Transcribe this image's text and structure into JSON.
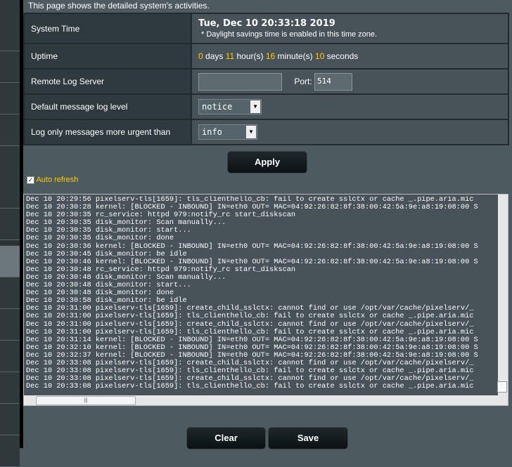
{
  "intro": "This page shows the detailed system's activities.",
  "rows": {
    "system_time": {
      "label": "System Time",
      "value": "Tue, Dec 10 20:33:18 2019",
      "note": "* Daylight savings time is enabled in this time zone."
    },
    "uptime": {
      "label": "Uptime",
      "days": "0",
      "days_label": " days ",
      "hours": "11",
      "hours_label": " hour(s) ",
      "minutes": "16",
      "minutes_label": " minute(s) ",
      "seconds": "10",
      "seconds_label": " seconds"
    },
    "remote_log": {
      "label": "Remote Log Server",
      "value": "",
      "port_label": "Port:",
      "port": "514"
    },
    "default_level": {
      "label": "Default message log level",
      "value": "notice"
    },
    "urgent": {
      "label": "Log only messages more urgent than",
      "value": "info"
    }
  },
  "apply_label": "Apply",
  "auto_refresh": {
    "label": "Auto refresh",
    "checked": true
  },
  "log_lines": [
    "Dec 10 20:29:56 pixelserv-tls[1659]: tls_clienthello_cb: fail to create sslctx or cache _.pipe.aria.mic",
    "Dec 10 20:30:28 kernel: [BLOCKED - INBOUND] IN=eth0 OUT= MAC=04:92:26:82:8f:38:00:42:5a:9e:a8:19:08:00 S",
    "Dec 10 20:30:35 rc_service: httpd 979:notify_rc start_diskscan",
    "Dec 10 20:30:35 disk_monitor: Scan manually...",
    "Dec 10 20:30:35 disk_monitor: start...",
    "Dec 10 20:30:35 disk_monitor: done",
    "Dec 10 20:30:36 kernel: [BLOCKED - INBOUND] IN=eth0 OUT= MAC=04:92:26:82:8f:38:00:42:5a:9e:a8:19:08:00 S",
    "Dec 10 20:30:45 disk_monitor: be idle",
    "Dec 10 20:30:46 kernel: [BLOCKED - INBOUND] IN=eth0 OUT= MAC=04:92:26:82:8f:38:00:42:5a:9e:a8:19:08:00 S",
    "Dec 10 20:30:48 rc_service: httpd 979:notify_rc start_diskscan",
    "Dec 10 20:30:48 disk_monitor: Scan manually...",
    "Dec 10 20:30:48 disk_monitor: start...",
    "Dec 10 20:30:48 disk_monitor: done",
    "Dec 10 20:30:58 disk_monitor: be idle",
    "Dec 10 20:31:00 pixelserv-tls[1659]: create_child_sslctx: cannot find or use /opt/var/cache/pixelserv/_",
    "Dec 10 20:31:00 pixelserv-tls[1659]: tls_clienthello_cb: fail to create sslctx or cache _.pipe.aria.mic",
    "Dec 10 20:31:00 pixelserv-tls[1659]: create_child_sslctx: cannot find or use /opt/var/cache/pixelserv/_",
    "Dec 10 20:31:00 pixelserv-tls[1659]: tls_clienthello_cb: fail to create sslctx or cache _.pipe.aria.mic",
    "Dec 10 20:31:14 kernel: [BLOCKED - INBOUND] IN=eth0 OUT= MAC=04:92:26:82:8f:38:00:42:5a:9e:a8:19:08:00 S",
    "Dec 10 20:32:10 kernel: [BLOCKED - INBOUND] IN=eth0 OUT= MAC=04:92:26:82:8f:38:00:42:5a:9e:a8:19:08:00 S",
    "Dec 10 20:32:37 kernel: [BLOCKED - INBOUND] IN=eth0 OUT= MAC=04:92:26:82:8f:38:00:42:5a:9e:a8:19:08:00 S",
    "Dec 10 20:33:08 pixelserv-tls[1659]: create_child_sslctx: cannot find or use /opt/var/cache/pixelserv/_",
    "Dec 10 20:33:08 pixelserv-tls[1659]: tls_clienthello_cb: fail to create sslctx or cache _.pipe.aria.mic",
    "Dec 10 20:33:08 pixelserv-tls[1659]: create_child_sslctx: cannot find or use /opt/var/cache/pixelserv/_",
    "Dec 10 20:33:08 pixelserv-tls[1659]: tls_clienthello_cb: fail to create sslctx or cache _.pipe.aria.mic"
  ],
  "clear_label": "Clear",
  "save_label": "Save",
  "colors": {
    "highlight": "#ffcc00",
    "background": "#4d5a60"
  }
}
